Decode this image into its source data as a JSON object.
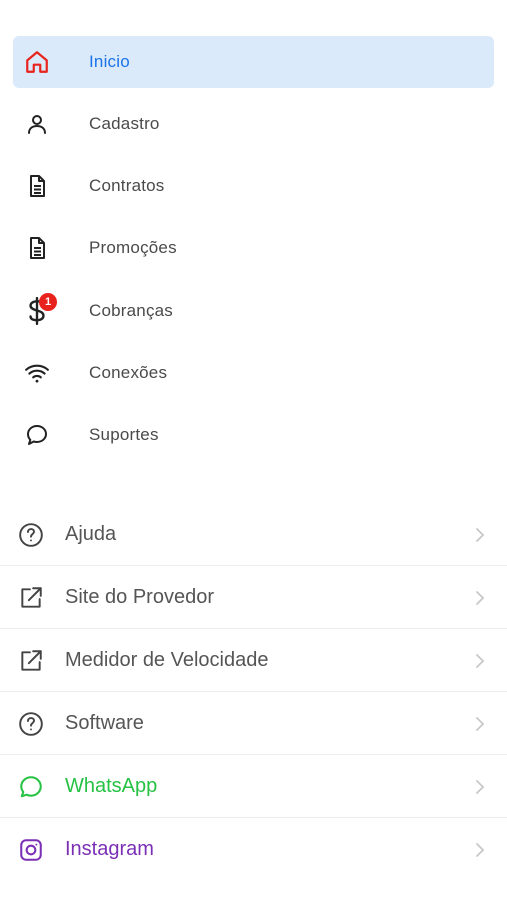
{
  "menu": {
    "items": [
      {
        "label": "Inicio",
        "icon": "home-icon",
        "active": true
      },
      {
        "label": "Cadastro",
        "icon": "user-icon"
      },
      {
        "label": "Contratos",
        "icon": "document-icon"
      },
      {
        "label": "Promoções",
        "icon": "document-icon"
      },
      {
        "label": "Cobranças",
        "icon": "dollar-icon",
        "badge": "1"
      },
      {
        "label": "Conexões",
        "icon": "wifi-icon"
      },
      {
        "label": "Suportes",
        "icon": "chat-bubble-icon"
      }
    ]
  },
  "links": [
    {
      "label": "Ajuda",
      "icon": "help-circle-icon",
      "color": "#555555"
    },
    {
      "label": "Site do Provedor",
      "icon": "external-link-icon",
      "color": "#555555"
    },
    {
      "label": "Medidor de Velocidade",
      "icon": "external-link-icon",
      "color": "#555555"
    },
    {
      "label": "Software",
      "icon": "help-circle-icon",
      "color": "#555555"
    },
    {
      "label": "WhatsApp",
      "icon": "whatsapp-icon",
      "color": "#25c244"
    },
    {
      "label": "Instagram",
      "icon": "instagram-icon",
      "color": "#7b2fb5"
    }
  ],
  "colors": {
    "active_bg": "#dbeafb",
    "active_text": "#1a73e8",
    "home_icon": "#e8221c",
    "badge": "#e8221c",
    "whatsapp": "#25c244",
    "instagram": "#7b2fb5"
  }
}
